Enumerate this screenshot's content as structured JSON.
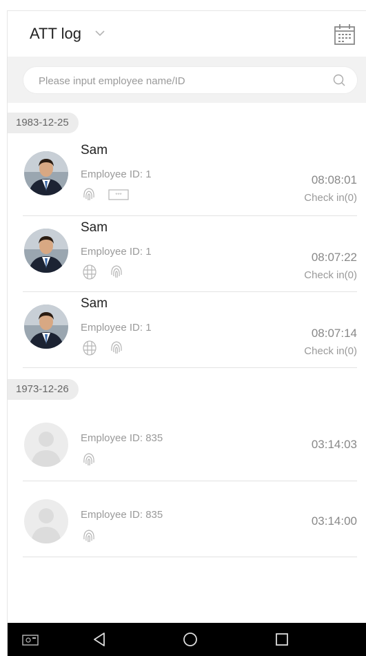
{
  "header": {
    "title": "ATT log",
    "dropdown_icon": "chevron-down-icon",
    "calendar_icon": "calendar-icon"
  },
  "search": {
    "placeholder": "Please input employee name/ID",
    "value": "",
    "icon": "search-icon"
  },
  "groups": [
    {
      "date": "1983-12-25",
      "records": [
        {
          "name": "Sam",
          "employee_id": "Employee ID: 1",
          "time": "08:08:01",
          "status": "Check in(0)",
          "methods": [
            "fingerprint",
            "password"
          ]
        },
        {
          "name": "Sam",
          "employee_id": "Employee ID: 1",
          "time": "08:07:22",
          "status": "Check in(0)",
          "methods": [
            "face",
            "fingerprint"
          ]
        },
        {
          "name": "Sam",
          "employee_id": "Employee ID: 1",
          "time": "08:07:14",
          "status": "Check in(0)",
          "methods": [
            "face",
            "fingerprint"
          ]
        }
      ]
    },
    {
      "date": "1973-12-26",
      "records": [
        {
          "name": "",
          "employee_id": "Employee ID: 835",
          "time": "03:14:03",
          "status": "",
          "methods": [
            "fingerprint"
          ]
        },
        {
          "name": "",
          "employee_id": "Employee ID: 835",
          "time": "03:14:00",
          "status": "",
          "methods": [
            "fingerprint"
          ]
        }
      ]
    }
  ],
  "navbar": {
    "buttons": [
      "screenshot-icon",
      "back-icon",
      "home-icon",
      "recents-icon"
    ]
  },
  "colors": {
    "text": "#222222",
    "secondary": "#999999",
    "divider": "#e2e2e2",
    "band": "#f2f2f2",
    "navbar": "#000000"
  }
}
